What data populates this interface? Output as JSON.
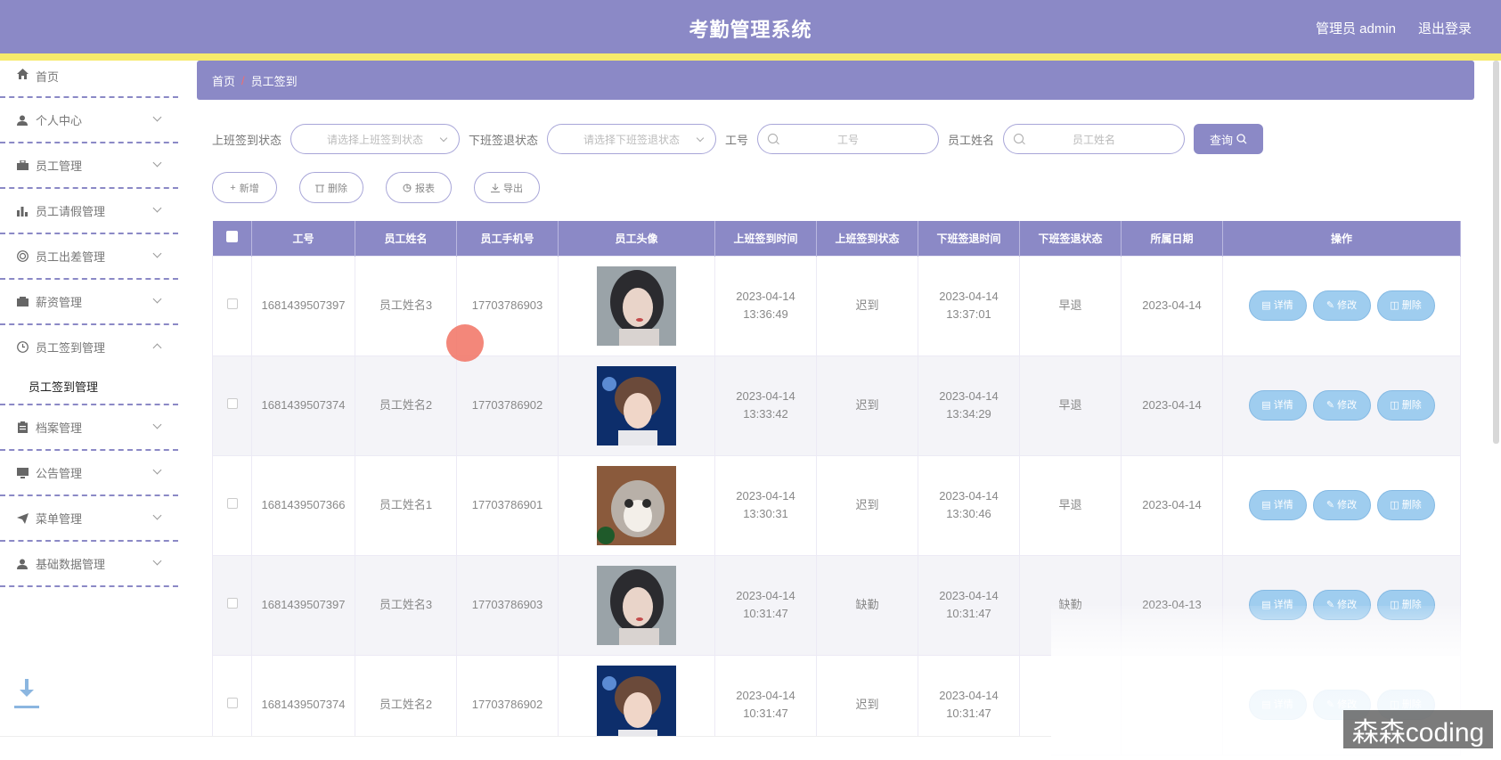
{
  "header": {
    "title": "考勤管理系统",
    "user": "管理员 admin",
    "logout": "退出登录"
  },
  "sidebar": {
    "items": [
      {
        "label": "首页",
        "icon": "home-icon"
      },
      {
        "label": "个人中心",
        "icon": "user-icon"
      },
      {
        "label": "员工管理",
        "icon": "briefcase-icon"
      },
      {
        "label": "员工请假管理",
        "icon": "bar-chart-icon"
      },
      {
        "label": "员工出差管理",
        "icon": "globe-icon"
      },
      {
        "label": "薪资管理",
        "icon": "wallet-icon"
      },
      {
        "label": "员工签到管理",
        "icon": "clock-icon"
      },
      {
        "label": "档案管理",
        "icon": "clipboard-icon"
      },
      {
        "label": "公告管理",
        "icon": "monitor-icon"
      },
      {
        "label": "菜单管理",
        "icon": "send-icon"
      },
      {
        "label": "基础数据管理",
        "icon": "user-icon"
      }
    ],
    "sub_item": "员工签到管理"
  },
  "breadcrumb": {
    "home": "首页",
    "separator": "/",
    "current": "员工签到"
  },
  "search": {
    "checkin_label": "上班签到状态",
    "checkin_placeholder": "请选择上班签到状态",
    "checkout_label": "下班签退状态",
    "checkout_placeholder": "请选择下班签退状态",
    "id_label": "工号",
    "id_placeholder": "工号",
    "name_label": "员工姓名",
    "name_placeholder": "员工姓名",
    "query_button": "查询"
  },
  "actions": {
    "add": "新增",
    "delete": "删除",
    "report": "报表",
    "export": "导出"
  },
  "table": {
    "columns": [
      "工号",
      "员工姓名",
      "员工手机号",
      "员工头像",
      "上班签到时间",
      "上班签到状态",
      "下班签退时间",
      "下班签退状态",
      "所属日期",
      "操作"
    ],
    "rows": [
      {
        "id": "1681439507397",
        "name": "员工姓名3",
        "phone": "17703786903",
        "avatar": "girl",
        "in_time": "2023-04-14 13:36:49",
        "in_status": "迟到",
        "out_time": "2023-04-14 13:37:01",
        "out_status": "早退",
        "date": "2023-04-14"
      },
      {
        "id": "1681439507374",
        "name": "员工姓名2",
        "phone": "17703786902",
        "avatar": "boy",
        "in_time": "2023-04-14 13:33:42",
        "in_status": "迟到",
        "out_time": "2023-04-14 13:34:29",
        "out_status": "早退",
        "date": "2023-04-14"
      },
      {
        "id": "1681439507366",
        "name": "员工姓名1",
        "phone": "17703786901",
        "avatar": "cat",
        "in_time": "2023-04-14 13:30:31",
        "in_status": "迟到",
        "out_time": "2023-04-14 13:30:46",
        "out_status": "早退",
        "date": "2023-04-14"
      },
      {
        "id": "1681439507397",
        "name": "员工姓名3",
        "phone": "17703786903",
        "avatar": "girl",
        "in_time": "2023-04-14 10:31:47",
        "in_status": "缺勤",
        "out_time": "2023-04-14 10:31:47",
        "out_status": "缺勤",
        "date": "2023-04-13"
      },
      {
        "id": "1681439507374",
        "name": "员工姓名2",
        "phone": "17703786902",
        "avatar": "boy",
        "in_time": "2023-04-14 10:31:47",
        "in_status": "迟到",
        "out_time": "2023-04-14 10:31:47",
        "out_status": "",
        "date": ""
      }
    ],
    "op_detail": "详情",
    "op_edit": "修改",
    "op_delete": "删除"
  },
  "watermark": "森森coding",
  "colors": {
    "primary": "#8b89c6",
    "accent_line": "#f6ea6b",
    "op_button": "#9fcdef"
  }
}
